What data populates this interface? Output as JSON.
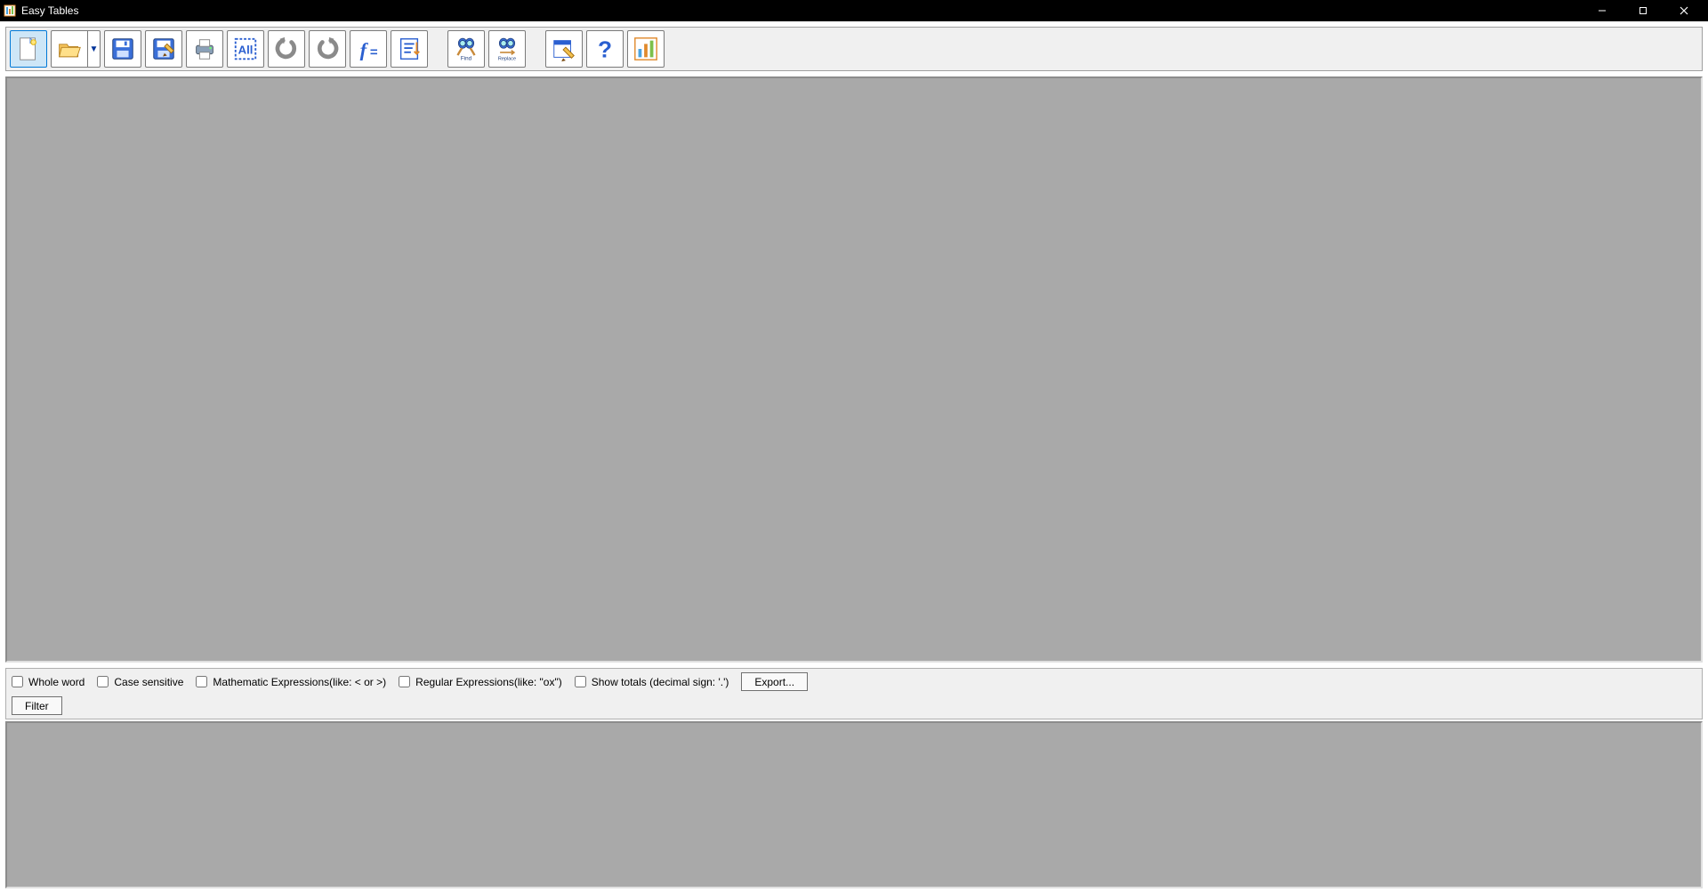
{
  "window": {
    "title": "Easy Tables"
  },
  "toolbar": {
    "new": "New",
    "open": "Open",
    "save": "Save",
    "edit": "Edit table",
    "print": "Print",
    "selectall": "Select All",
    "undo": "Undo",
    "redo": "Redo",
    "formula": "Formula",
    "sort": "Sort",
    "find": "Find",
    "find_caption": "Find",
    "replace": "Replace",
    "replace_caption": "Replace",
    "options": "Options",
    "help": "Help",
    "chart": "Chart"
  },
  "filter": {
    "whole_word": "Whole word",
    "case_sensitive": "Case sensitive",
    "math_expr": "Mathematic Expressions(like: < or >)",
    "regex": "Regular Expressions(like: \"ox\")",
    "show_totals": "Show totals (decimal sign: '.')",
    "export": "Export...",
    "filter": "Filter"
  }
}
